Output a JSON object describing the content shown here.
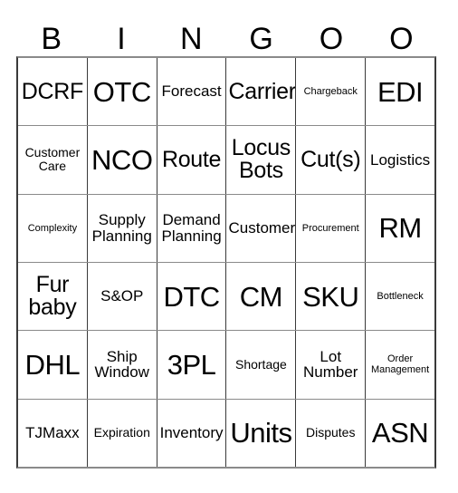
{
  "card": {
    "header": {
      "letters": [
        "B",
        "I",
        "N",
        "G",
        "O",
        "O"
      ]
    },
    "grid": {
      "rows": [
        [
          {
            "text": "DCRF",
            "size": "fs-lg"
          },
          {
            "text": "OTC",
            "size": "fs-xl"
          },
          {
            "text": "Forecast",
            "size": "fs-md"
          },
          {
            "text": "Carrier",
            "size": "fs-lg"
          },
          {
            "text": "Chargeback",
            "size": "fs-xs"
          },
          {
            "text": "EDI",
            "size": "fs-xl"
          }
        ],
        [
          {
            "text": "Customer\nCare",
            "size": "fs-sm"
          },
          {
            "text": "NCO",
            "size": "fs-xl"
          },
          {
            "text": "Route",
            "size": "fs-lg"
          },
          {
            "text": "Locus\nBots",
            "size": "fs-lg"
          },
          {
            "text": "Cut(s)",
            "size": "fs-lg"
          },
          {
            "text": "Logistics",
            "size": "fs-md"
          }
        ],
        [
          {
            "text": "Complexity",
            "size": "fs-xs"
          },
          {
            "text": "Supply\nPlanning",
            "size": "fs-md"
          },
          {
            "text": "Demand\nPlanning",
            "size": "fs-md"
          },
          {
            "text": "Customer",
            "size": "fs-md"
          },
          {
            "text": "Procurement",
            "size": "fs-xs"
          },
          {
            "text": "RM",
            "size": "fs-xl"
          }
        ],
        [
          {
            "text": "Fur\nbaby",
            "size": "fs-lg"
          },
          {
            "text": "S&OP",
            "size": "fs-md"
          },
          {
            "text": "DTC",
            "size": "fs-xl"
          },
          {
            "text": "CM",
            "size": "fs-xl"
          },
          {
            "text": "SKU",
            "size": "fs-xl"
          },
          {
            "text": "Bottleneck",
            "size": "fs-xs"
          }
        ],
        [
          {
            "text": "DHL",
            "size": "fs-xl"
          },
          {
            "text": "Ship\nWindow",
            "size": "fs-md"
          },
          {
            "text": "3PL",
            "size": "fs-xl"
          },
          {
            "text": "Shortage",
            "size": "fs-sm"
          },
          {
            "text": "Lot\nNumber",
            "size": "fs-md"
          },
          {
            "text": "Order\nManagement",
            "size": "fs-xs"
          }
        ],
        [
          {
            "text": "TJMaxx",
            "size": "fs-md"
          },
          {
            "text": "Expiration",
            "size": "fs-sm"
          },
          {
            "text": "Inventory",
            "size": "fs-md"
          },
          {
            "text": "Units",
            "size": "fs-xl"
          },
          {
            "text": "Disputes",
            "size": "fs-sm"
          },
          {
            "text": "ASN",
            "size": "fs-xl"
          }
        ]
      ]
    },
    "colors": {
      "background": "#ffffff",
      "text": "#000000",
      "grid_line_dark": "#3a3a3a",
      "grid_line_light": "#8a8a8a"
    }
  }
}
